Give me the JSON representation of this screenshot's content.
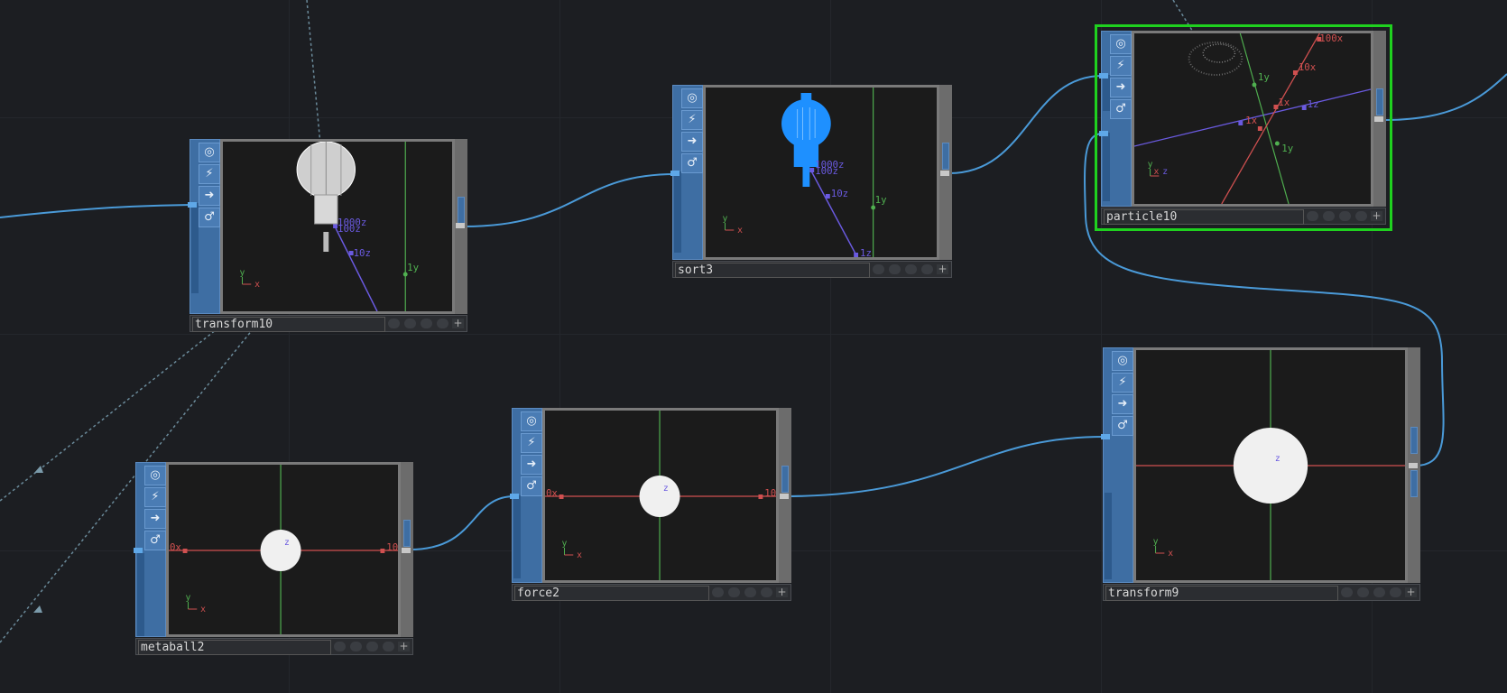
{
  "colors": {
    "background": "#1c1e22",
    "wire": "#4a9ad8",
    "node_blue": "#3e6ea3",
    "selection": "#1fd11f",
    "axis_x": "#d05050",
    "axis_y": "#50b050",
    "axis_z": "#6a5ae0"
  },
  "tool_icons": [
    "viewer-icon",
    "bypass-icon",
    "export-icon",
    "lock-icon"
  ],
  "tool_glyphs": [
    "◎",
    "⚡",
    "➜",
    "♂"
  ],
  "plus_glyph": "+",
  "nodes": {
    "transform10": {
      "name": "transform10",
      "labels": {
        "z1000": "1000z",
        "z100": "100z",
        "z10": "10z",
        "y1": "1y",
        "gy": "y",
        "gx": "x"
      }
    },
    "sort3": {
      "name": "sort3",
      "labels": {
        "z1000": "1000z",
        "z100": "100z",
        "z10": "10z",
        "y1": "1y",
        "z1": "1z",
        "gy": "y",
        "gx": "x"
      }
    },
    "particle10": {
      "name": "particle10",
      "labels": {
        "x100": "100x",
        "x10": "10x",
        "x1": "1x",
        "xn1": "1x",
        "y1": "1y",
        "yn1": "1y",
        "z1": "1z",
        "gy": "y",
        "gx": "x",
        "gz": "z"
      }
    },
    "metaball2": {
      "name": "metaball2",
      "labels": {
        "left": "0x",
        "right": "10",
        "z": "z",
        "gy": "y",
        "gx": "x"
      }
    },
    "force2": {
      "name": "force2",
      "labels": {
        "left": "0x",
        "right": "10",
        "z": "z",
        "gy": "y",
        "gx": "x"
      }
    },
    "transform9": {
      "name": "transform9",
      "labels": {
        "z": "z",
        "gy": "y",
        "gx": "x"
      }
    }
  }
}
